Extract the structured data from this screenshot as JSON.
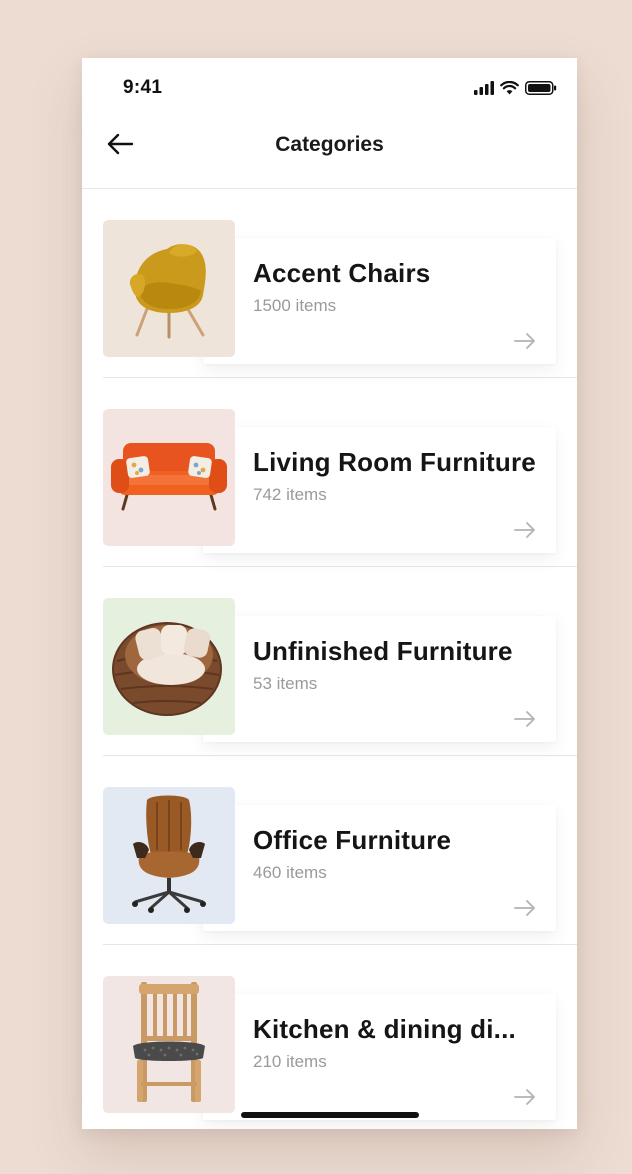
{
  "status_bar": {
    "time": "9:41"
  },
  "header": {
    "title": "Categories",
    "back_icon": "arrow-left-icon"
  },
  "categories": [
    {
      "name": "Accent Chairs",
      "count": "1500 items",
      "thumb_bg": "#efe4da",
      "image": "accent-chair"
    },
    {
      "name": "Living Room Furniture",
      "count": "742 items",
      "thumb_bg": "#f3e4e1",
      "image": "sofa"
    },
    {
      "name": "Unfinished Furniture",
      "count": "53 items",
      "thumb_bg": "#e5f0df",
      "image": "wicker-chair"
    },
    {
      "name": "Office Furniture",
      "count": "460 items",
      "thumb_bg": "#e3e9f3",
      "image": "office-chair"
    },
    {
      "name": "Kitchen & dining di...",
      "count": "210 items",
      "thumb_bg": "#f1e6e3",
      "image": "dining-chair"
    }
  ],
  "colors": {
    "background": "#ecdcd2",
    "surface": "#ffffff",
    "title_text": "#151515",
    "secondary_text": "#9a9a9a"
  }
}
